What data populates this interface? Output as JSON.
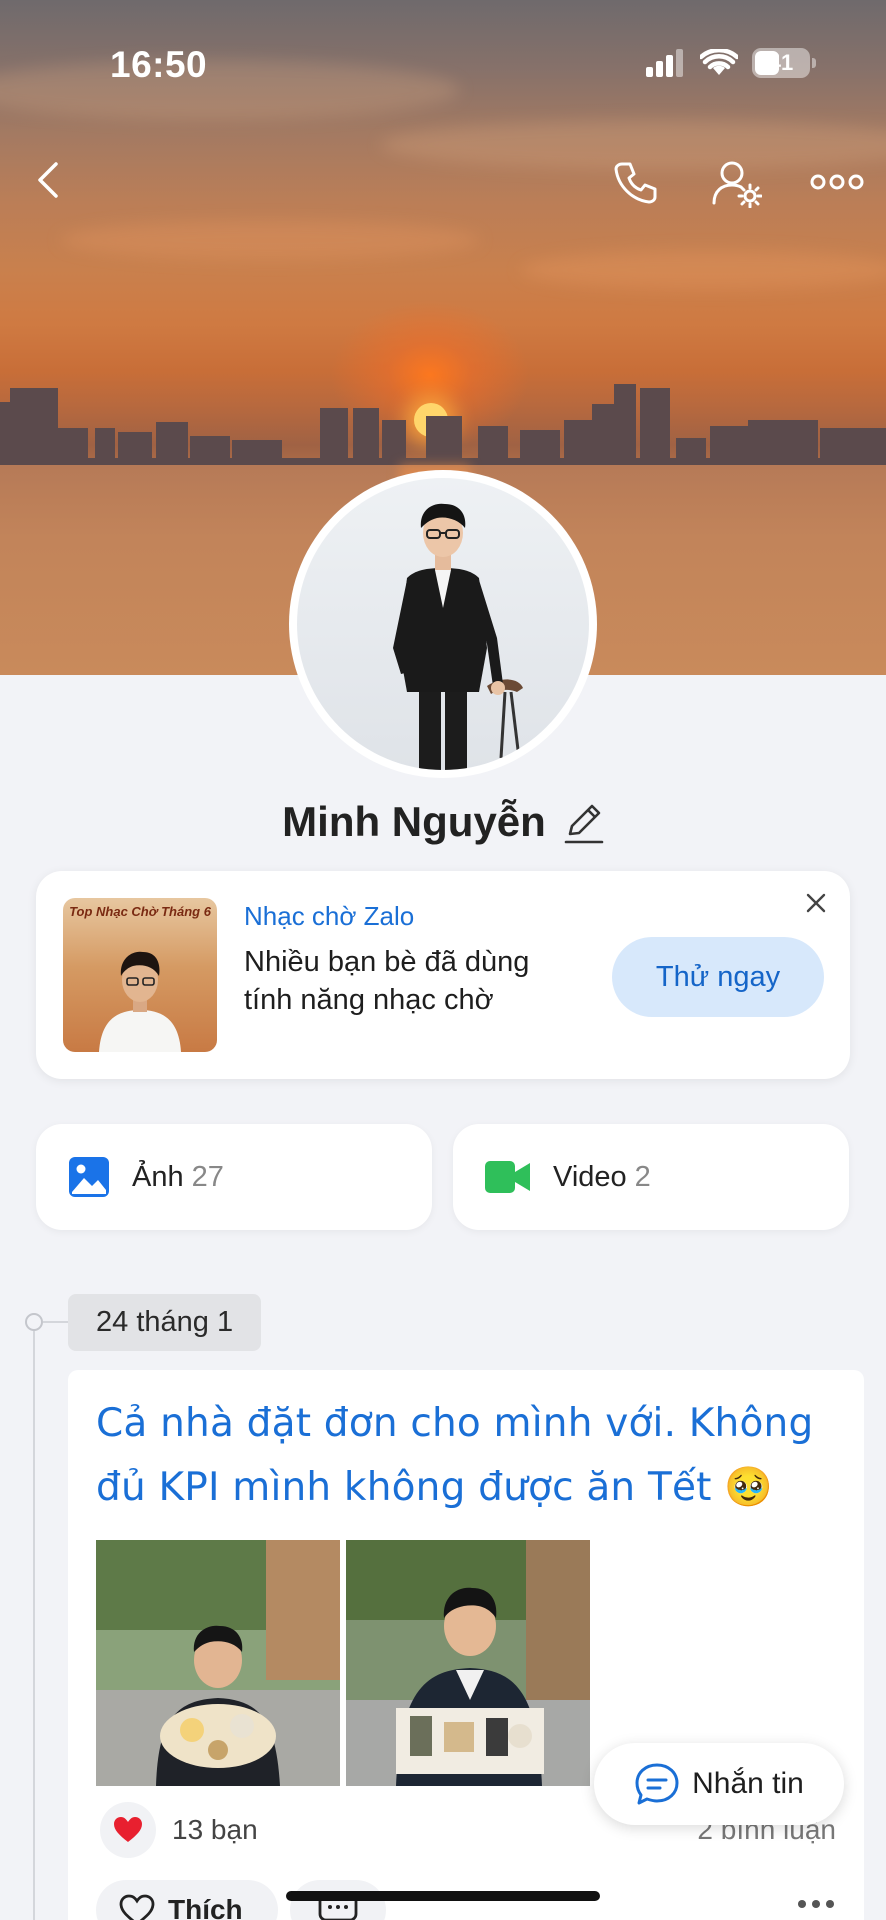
{
  "status_bar": {
    "time": "16:50",
    "battery": "41",
    "icons": [
      "cellular-signal-icon",
      "wifi-icon",
      "battery-icon"
    ]
  },
  "header": {
    "icons": [
      "back-icon",
      "phone-icon",
      "user-settings-icon",
      "more-icon"
    ]
  },
  "profile": {
    "name": "Minh Nguyễn",
    "edit_icon": "pencil-icon"
  },
  "promo": {
    "thumb_title": "Top Nhạc Chờ Tháng 6",
    "kicker": "Nhạc chờ Zalo",
    "text": "Nhiều bạn bè đã dùng tính năng nhạc chờ",
    "button": "Thử ngay",
    "accent": "#1a6fd6",
    "button_bg": "#d7e8fb"
  },
  "media": {
    "photos": {
      "label": "Ảnh",
      "count": "27",
      "color": "#1a73e8"
    },
    "videos": {
      "label": "Video",
      "count": "2",
      "color": "#2fbf5a"
    }
  },
  "timeline": {
    "date": "24 tháng 1",
    "post": {
      "text": "Cả nhà đặt đơn cho mình với. Không đủ KPI mình không được ăn Tết 🥹",
      "reactions": "13 bạn",
      "comments": "2 bình luận",
      "like_label": "Thích"
    }
  },
  "fab": {
    "label": "Nhắn tin"
  }
}
